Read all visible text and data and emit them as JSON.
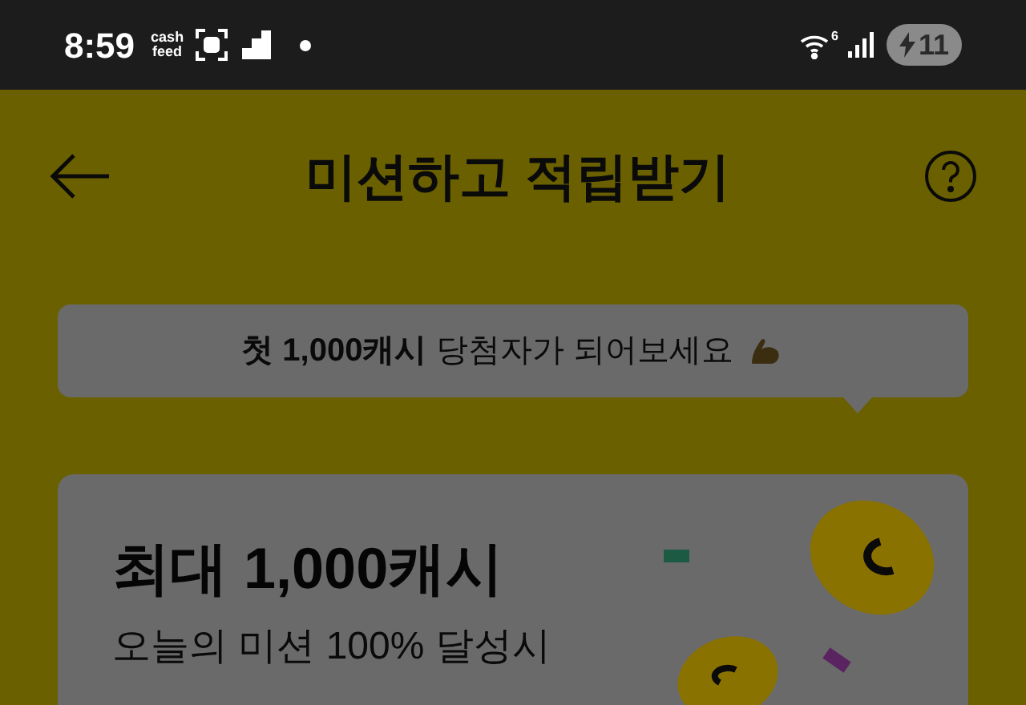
{
  "status_bar": {
    "time": "8:59",
    "app_logo": [
      "cash",
      "feed"
    ],
    "wifi_badge": "6",
    "battery": "11"
  },
  "header": {
    "title": "미션하고 적립받기"
  },
  "bubble": {
    "text": "**첫 1,000캐시** 당첨자가 되어보세요"
  },
  "card": {
    "title": "최대 1,000캐시",
    "subtitle": "오늘의 미션 100% 달성시"
  }
}
